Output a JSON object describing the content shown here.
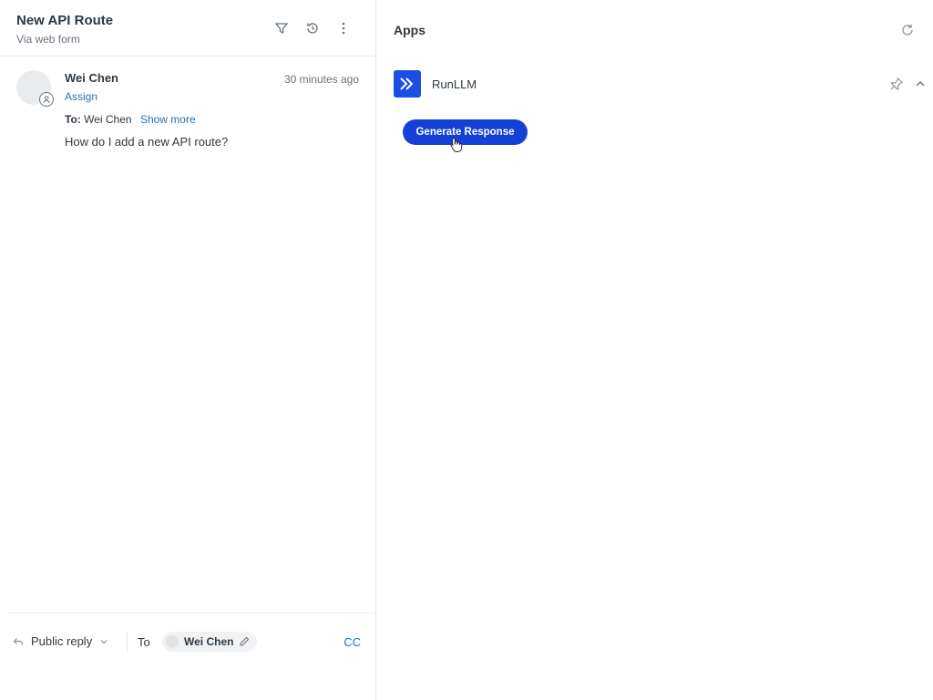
{
  "ticket": {
    "title": "New API Route",
    "channel": "Via web form",
    "icons": [
      "filter-icon",
      "history-icon",
      "more-vertical-icon"
    ]
  },
  "message": {
    "author": "Wei Chen",
    "timestamp": "30 minutes ago",
    "assign_label": "Assign",
    "to_label": "To:",
    "to_value": "Wei Chen",
    "show_more_label": "Show more",
    "body": "How do I add a new API route?"
  },
  "composer": {
    "reply_type": "Public reply",
    "to_label": "To",
    "recipient": "Wei Chen",
    "cc_label": "CC"
  },
  "apps_panel": {
    "title": "Apps",
    "app": {
      "name": "RunLLM",
      "brand_color": "#1b4fe4",
      "action_label": "Generate Response",
      "action_color": "#1440d8"
    }
  }
}
